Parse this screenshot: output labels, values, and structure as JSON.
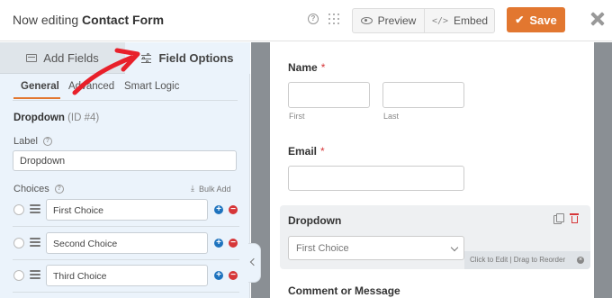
{
  "header": {
    "title_prefix": "Now editing",
    "title_form": "Contact Form",
    "preview_label": "Preview",
    "embed_label": "Embed",
    "save_label": "Save",
    "save_color": "#e27730"
  },
  "sidebar": {
    "tabs": [
      {
        "label": "Add Fields",
        "icon": "list-icon"
      },
      {
        "label": "Field Options",
        "icon": "sliders-icon",
        "active": true
      }
    ],
    "subtabs": [
      {
        "label": "General",
        "active": true
      },
      {
        "label": "Advanced"
      },
      {
        "label": "Smart Logic"
      }
    ],
    "field_title": "Dropdown",
    "field_id": "(ID #4)",
    "label_title": "Label",
    "label_value": "Dropdown",
    "choices_title": "Choices",
    "bulk_add_label": "Bulk Add",
    "choices": [
      "First Choice",
      "Second Choice",
      "Third Choice"
    ]
  },
  "form": {
    "name_label": "Name",
    "required_mark": "*",
    "first_sublabel": "First",
    "last_sublabel": "Last",
    "email_label": "Email",
    "dropdown_label": "Dropdown",
    "dropdown_value": "First Choice",
    "edit_hint": "Click to Edit | Drag to Reorder",
    "comment_label": "Comment or Message"
  },
  "annotation": {
    "arrow_color": "#e8202a"
  }
}
